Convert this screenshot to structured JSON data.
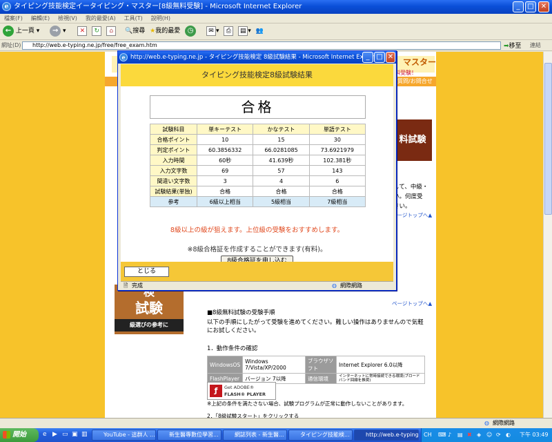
{
  "window": {
    "title": "タイピング技能検定イータイピング・マスター[8級無料受験] - Microsoft Internet Explorer"
  },
  "menu": [
    "檔案(F)",
    "編輯(E)",
    "檢視(V)",
    "我的最愛(A)",
    "工具(T)",
    "說明(H)"
  ],
  "toolbar": {
    "back": "上一頁",
    "search": "搜尋",
    "favorites": "我的最愛"
  },
  "address": {
    "label": "網址(D)",
    "url": "http://web.e-typing.ne.jp/free/free_exam.htm",
    "go": "移至",
    "links": "連結"
  },
  "page": {
    "logo_text": "マスター",
    "free_text": "料受験！",
    "nav_text": "質問/お問合せ",
    "banner_text": "料試験",
    "side_text1": "して、中級・",
    "side_text2": "い。何度受",
    "side_text3": "さい。",
    "page_top_1": "ページトップへ▲",
    "page_top_2": "ページトップへ▲",
    "promo_line1": "検",
    "promo_line2": "試験",
    "promo_caption": "級選びの参考に",
    "steps_heading": "■8級無料試験の受験手順",
    "steps_text": "以下の手順にしたがって受験を進めてください。難しい操作はありませんので気軽にお試しください。",
    "section1": "1．動作条件の確認",
    "req": {
      "os_label": "WindowsOS",
      "os_value": "Windows 7/Vista/XP/2000",
      "browser_label": "ブラウザソフト",
      "browser_value": "Internet Explorer 6.0以降",
      "flash_label": "FlashPlayer",
      "flash_value": "バージョン 7以降",
      "net_label": "通信環境",
      "net_value": "インターネットに常時接続できる環境(ブロードバンド回線を推奨)"
    },
    "flash_get": "Get ADOBE®",
    "flash_player": "FLASH® PLAYER",
    "req_note": "※上記の条件を満たさない場合、試験プログラムが正常に動作しないことがあります。",
    "section2": "2．「8級試験スタート」をクリックする"
  },
  "popup": {
    "title": "http://web.e-typing.ne.jp - タイピング技能検定 8級試験結果 - Microsoft Internet Explorer",
    "header": "タイピング技能検定8級試験結果",
    "result": "合格",
    "columns": [
      "試験科目",
      "単キーテスト",
      "かなテスト",
      "単語テスト"
    ],
    "rows": [
      {
        "label": "合格ポイント",
        "values": [
          "10",
          "15",
          "30"
        ]
      },
      {
        "label": "判定ポイント",
        "values": [
          "60.3856332",
          "66.0281085",
          "73.6921979"
        ]
      },
      {
        "label": "入力時間",
        "values": [
          "60秒",
          "41.639秒",
          "102.381秒"
        ]
      },
      {
        "label": "入力文字数",
        "values": [
          "69",
          "57",
          "143"
        ]
      },
      {
        "label": "間違い文字数",
        "values": [
          "3",
          "4",
          "6"
        ]
      },
      {
        "label": "試験結果(単独)",
        "values": [
          "合格",
          "合格",
          "合格"
        ]
      },
      {
        "label": "参考",
        "values": [
          "6級以上相当",
          "5級相当",
          "7級相当"
        ]
      }
    ],
    "warning": "8級以上の級が狙えます。上位級の受験をおすすめします。",
    "note": "※8級合格証を作成することができます(有料)。",
    "apply_button": "8級合格証を申し込む",
    "close_button": "とじる",
    "status": "完成",
    "zone": "網際網路"
  },
  "statusbar": {
    "zone": "網際網路"
  },
  "taskbar": {
    "start": "開始",
    "items": [
      "YouTube - 這群人 ...",
      "新生醫專數位學習...",
      "網誌列表 - 新生醫...",
      "タイピング技能検...",
      "http://web.e-typing.n..."
    ],
    "lang": "CH",
    "time": "下午 03:49"
  }
}
